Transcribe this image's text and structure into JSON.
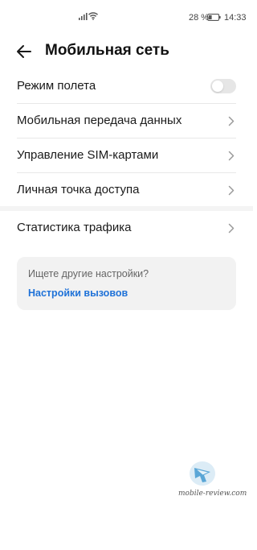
{
  "status_bar": {
    "battery_percent": "28 %",
    "time": "14:33",
    "icons": [
      "signal-icon",
      "wifi-icon",
      "battery-icon"
    ]
  },
  "header": {
    "title": "Мобильная сеть",
    "back_icon": "arrow-left-icon"
  },
  "settings": {
    "items": [
      {
        "label": "Режим полета",
        "control": "toggle",
        "toggle_on": false
      },
      {
        "label": "Мобильная передача данных",
        "control": "chevron"
      },
      {
        "label": "Управление SIM-картами",
        "control": "chevron"
      },
      {
        "label": "Личная точка доступа",
        "control": "chevron"
      }
    ],
    "traffic": {
      "label": "Статистика трафика",
      "control": "chevron"
    }
  },
  "suggestion": {
    "title": "Ищете другие настройки?",
    "link": "Настройки вызовов"
  },
  "watermark": {
    "text": "mobile-review.com"
  },
  "colors": {
    "accent_link": "#1f72d8",
    "toggle_off": "#e6e6e6",
    "card_bg": "#f2f2f2",
    "divider": "#e8e8e8"
  }
}
